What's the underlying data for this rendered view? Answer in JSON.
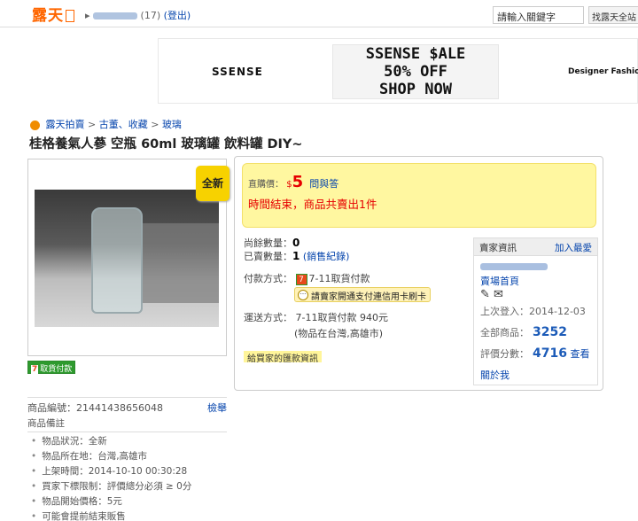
{
  "topbar": {
    "logo": "露天",
    "user_count": "(17)",
    "logout": "(登出)",
    "search_value": "請輸入關鍵字",
    "search_button": "找露天全站"
  },
  "banner": {
    "left": "SSENSE",
    "mid_line1": "SSENSE $ALE",
    "mid_line2": "50% OFF",
    "mid_line3": "SHOP NOW",
    "right": "Designer Fashio"
  },
  "breadcrumb": [
    "露天拍賣",
    "古董、收藏",
    "玻璃"
  ],
  "title": "桂格養氣人蔘 空瓶 60ml 玻璃罐 飲料罐 DIY~",
  "badges": {
    "new": "全新",
    "cod": "取貨付款",
    "cod_seven": "7"
  },
  "price": {
    "label": "直購價：",
    "currency": "$",
    "value": "5",
    "ask": "問與答",
    "end_message": "時間結束，商品共賣出1件"
  },
  "info": {
    "remaining_label": "尚餘數量：",
    "remaining_value": "0",
    "sold_label": "已賣數量：",
    "sold_value": "1",
    "sold_link": "(銷售紀錄)",
    "payment_label": "付款方式：",
    "payment_value": "7-11取貨付款",
    "credit_hint": "請賣家開通支付連信用卡刷卡",
    "shipping_label": "運送方式：",
    "shipping_value": "7-11取貨付款",
    "shipping_fee": "940元",
    "location": "(物品在台灣,高雄市)",
    "remit": "給買家的匯款資訊"
  },
  "seller": {
    "header": "賣家資訊",
    "add_fav": "加入最愛",
    "store_home": "賣場首頁",
    "last_login_label": "上次登入：",
    "last_login": "2014-12-03",
    "all_items_label": "全部商品：",
    "all_items": "3252",
    "rating_label": "評價分數：",
    "rating": "4716",
    "rating_link": "查看",
    "about": "關於我"
  },
  "product": {
    "id_label": "商品編號：",
    "id": "21441438656048",
    "report": "檢舉",
    "notes_header": "商品備註",
    "notes": [
      "物品狀況：全新",
      "物品所在地：台灣,高雄市",
      "上架時間：2014-10-10 00:30:28",
      "買家下標限制：評價總分必須 ≥ 0分",
      "物品開始價格：5元",
      "可能會提前結束販售"
    ]
  },
  "colors": {
    "brand": "#ff6600",
    "price": "#e60000",
    "link": "#0645ad",
    "price_bg": "#fff7a0"
  }
}
